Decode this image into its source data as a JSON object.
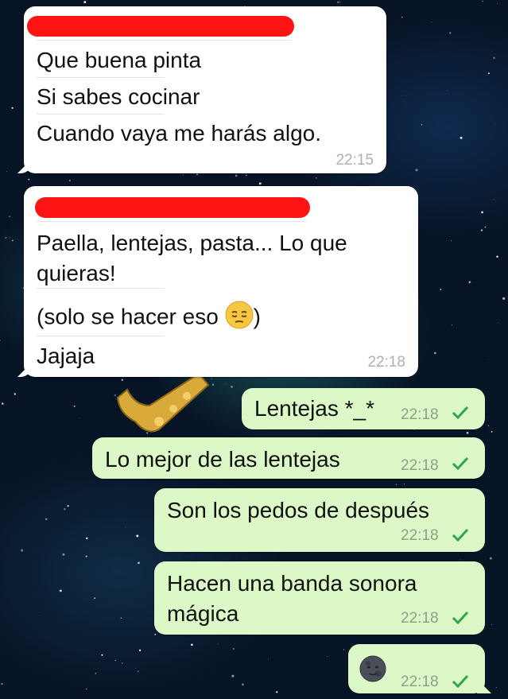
{
  "messages": [
    {
      "direction": "incoming",
      "sender_redacted": true,
      "lines": [
        "Que buena pinta",
        "Si sabes cocinar",
        "Cuando vaya me harás algo."
      ],
      "time": "22:15"
    },
    {
      "direction": "incoming",
      "sender_redacted": true,
      "lines": [
        "Paella, lentejas, pasta...  Lo que",
        "quieras!",
        "(solo se hacer eso ",
        ")",
        "Jajaja"
      ],
      "emoji": "pensive-face",
      "time": "22:18"
    },
    {
      "direction": "outgoing",
      "text": "Lentejas *_*",
      "time": "22:18",
      "status": "sent-check"
    },
    {
      "direction": "outgoing",
      "text": "Lo mejor de las lentejas",
      "time": "22:18",
      "status": "sent-check"
    },
    {
      "direction": "outgoing",
      "text": "Son los pedos de después",
      "time": "22:18",
      "status": "sent-check"
    },
    {
      "direction": "outgoing",
      "lines": [
        "Hacen una banda sonora",
        "mágica"
      ],
      "time": "22:18",
      "status": "sent-check"
    },
    {
      "direction": "outgoing",
      "emoji": "new-moon-face",
      "time": "22:18",
      "status": "sent-check"
    }
  ],
  "colors": {
    "incoming_bubble": "#ffffff",
    "outgoing_bubble": "#dcf8c6",
    "redaction": "#ff1414",
    "check": "#2aa845",
    "background": "#071426"
  }
}
